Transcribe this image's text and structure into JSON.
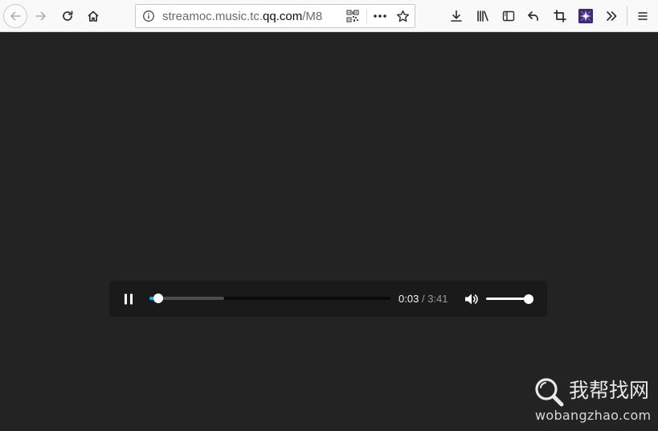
{
  "browser": {
    "url": {
      "pre": "streamoc.music.tc.",
      "domain": "qq.com",
      "post": "/M8"
    },
    "icons": {
      "back": "back-arrow-icon",
      "forward": "forward-arrow-icon",
      "reload": "reload-icon",
      "home": "home-icon",
      "info": "info-icon",
      "qr": "qr-code-icon",
      "page_actions": "more-dots-icon",
      "bookmark": "star-icon",
      "downloads": "download-icon",
      "library": "library-icon",
      "sidebar": "sidebar-icon",
      "undo": "undo-icon",
      "screenshot": "crop-icon",
      "extension": "extension-icon",
      "overflow": "double-chevron-icon",
      "menu": "hamburger-menu-icon"
    }
  },
  "player": {
    "state": "playing",
    "current_time": "0:03",
    "separator": "/",
    "duration": "3:41",
    "progress_fraction": 0.0136,
    "buffered_fraction": 0.31,
    "volume_fraction": 1.0,
    "accent_color": "#00b6f0",
    "icons": {
      "pause": "pause-icon",
      "volume": "speaker-icon"
    }
  },
  "watermark": {
    "title": "我帮找网",
    "url": "wobangzhao.com",
    "icon": "magnifier-icon"
  }
}
